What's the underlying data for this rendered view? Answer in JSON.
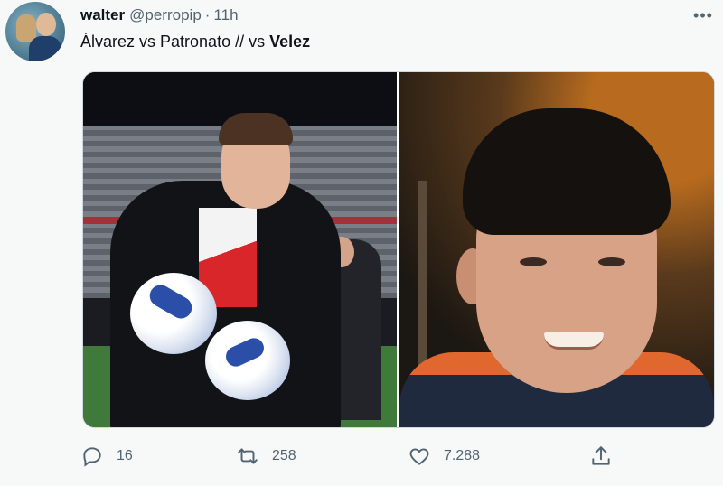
{
  "tweet": {
    "display_name": "walter",
    "handle": "@perropip",
    "separator": "·",
    "time": "11h",
    "text_part1": "Álvarez vs Patronato // vs ",
    "text_bold": "Velez",
    "more_label": "•••"
  },
  "actions": {
    "replies": "16",
    "retweets": "258",
    "likes": "7.288"
  },
  "icons": [
    "reply-icon",
    "retweet-icon",
    "like-icon",
    "share-icon",
    "more-icon"
  ],
  "colors": {
    "background": "#f7f9f9",
    "text": "#0f1419",
    "secondary_text": "#536471"
  }
}
